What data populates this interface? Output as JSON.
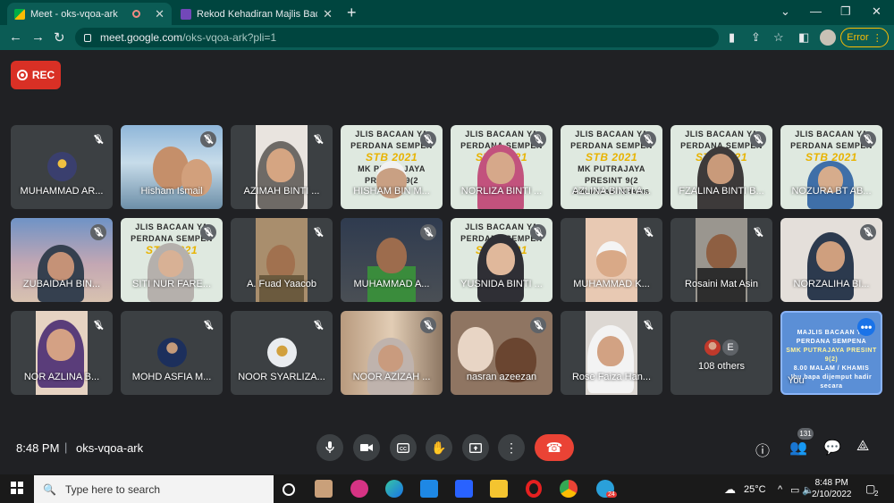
{
  "browser": {
    "tabs": [
      {
        "title": "Meet - oks-vqoa-ark"
      },
      {
        "title": "Rekod Kehadiran Majlis Bacaan Y"
      }
    ],
    "url_host": "meet.google.com",
    "url_path": "/oks-vqoa-ark?pli=1",
    "error_label": "Error"
  },
  "meet": {
    "rec_label": "REC",
    "time": "8:48 PM",
    "separator": "|",
    "meeting_code": "oks-vqoa-ark",
    "people_count": "131",
    "others_label": "108 others",
    "others_initial": "E",
    "banner": {
      "line1": "JLIS BACAAN YA",
      "line2": "PERDANA SEMPEN",
      "line3": "STB 2021",
      "line4": "MK PUTRAJAYA PRESINT 9(2",
      "line5": "8.00 MALAM / KHAMIS",
      "line6": "uy bapa dijemput hadir secara m"
    },
    "you_banner": {
      "line1": "MAJLIS BACAAN YA",
      "line2": "PERDANA SEMPENA",
      "line3": "SMK PUTRAJAYA PRESINT 9(2)",
      "line4": "8.00 MALAM / KHAMIS",
      "line5": "Ibu bapa dijemput hadir secara"
    },
    "participants": [
      {
        "name": "MUHAMMAD AR..."
      },
      {
        "name": "Hisham Ismail"
      },
      {
        "name": "AZIMAH BINTI ..."
      },
      {
        "name": "HISHAM BIN M..."
      },
      {
        "name": "NORLIZA BINTI ..."
      },
      {
        "name": "AZLINA BINTI A..."
      },
      {
        "name": "FZALINA BINTI B..."
      },
      {
        "name": "NOZURA BT AB..."
      },
      {
        "name": "ZUBAIDAH BIN..."
      },
      {
        "name": "SITI NUR FARE..."
      },
      {
        "name": "A. Fuad Yaacob"
      },
      {
        "name": "MUHAMMAD A..."
      },
      {
        "name": "YUSNIDA BINTI ..."
      },
      {
        "name": "MUHAMMAD K..."
      },
      {
        "name": "Rosaini Mat Asin"
      },
      {
        "name": "NORZALIHA BI..."
      },
      {
        "name": "NOR AZLINA B..."
      },
      {
        "name": "MOHD ASFIA M..."
      },
      {
        "name": "NOOR SYARLIZA..."
      },
      {
        "name": "NOOR AZIZAH ..."
      },
      {
        "name": "nasran azeezan"
      },
      {
        "name": "Rose Faiza Han..."
      },
      {
        "name": "You"
      }
    ]
  },
  "taskbar": {
    "search_placeholder": "Type here to search",
    "weather": "25°C",
    "time": "8:48 PM",
    "date": "2/10/2022",
    "notif_count": "2",
    "telegram_badge": "24"
  }
}
